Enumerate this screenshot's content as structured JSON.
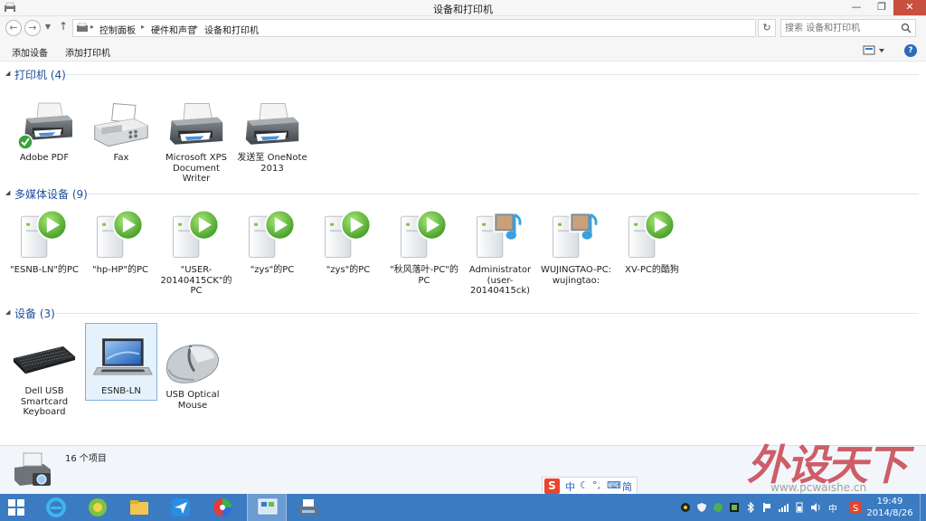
{
  "window": {
    "title": "设备和打印机"
  },
  "address": {
    "crumbs": [
      "控制面板",
      "硬件和声音",
      "设备和打印机"
    ]
  },
  "search": {
    "placeholder": "搜索 设备和打印机"
  },
  "commands": {
    "add_device": "添加设备",
    "add_printer": "添加打印机"
  },
  "sections": {
    "printers": {
      "title": "打印机 (4)",
      "items": [
        {
          "label": "Adobe PDF",
          "icon": "printer-default-icon"
        },
        {
          "label": "Fax",
          "icon": "fax-icon"
        },
        {
          "label": "Microsoft XPS Document Writer",
          "icon": "printer-icon"
        },
        {
          "label": "发送至 OneNote 2013",
          "icon": "printer-icon"
        }
      ]
    },
    "media": {
      "title": "多媒体设备 (9)",
      "items": [
        {
          "label": "\"ESNB-LN\"的PC",
          "icon": "media-server-icon"
        },
        {
          "label": "\"hp-HP\"的PC",
          "icon": "media-server-icon"
        },
        {
          "label": "\"USER-20140415CK\"的PC",
          "icon": "media-server-icon"
        },
        {
          "label": "\"zys\"的PC",
          "icon": "media-server-icon"
        },
        {
          "label": "\"zys\"的PC",
          "icon": "media-server-icon"
        },
        {
          "label": "\"秋风落叶-PC\"的PC",
          "icon": "media-server-icon"
        },
        {
          "label": "Administrator (user-20140415ck)",
          "icon": "media-music-server-icon"
        },
        {
          "label": "WUJINGTAO-PC: wujingtao:",
          "icon": "media-music-server-icon"
        },
        {
          "label": "XV-PC的酷狗",
          "icon": "media-server-icon"
        }
      ]
    },
    "devices": {
      "title": "设备 (3)",
      "items": [
        {
          "label": "Dell USB Smartcard Keyboard",
          "icon": "keyboard-icon"
        },
        {
          "label": "ESNB-LN",
          "icon": "laptop-icon"
        },
        {
          "label": "USB Optical Mouse",
          "icon": "mouse-icon"
        }
      ]
    }
  },
  "details": {
    "count": "16 个项目"
  },
  "ime": {
    "lang": "中"
  },
  "tray": {
    "lang": "中",
    "time": "19:49",
    "date": "2014/8/26"
  },
  "watermark": {
    "big": "外设天下",
    "url": "www.pcwaishe.cn"
  },
  "colors": {
    "accent": "#1f4e9e",
    "taskbar": "#3a7bc2",
    "close": "#c7503f"
  }
}
